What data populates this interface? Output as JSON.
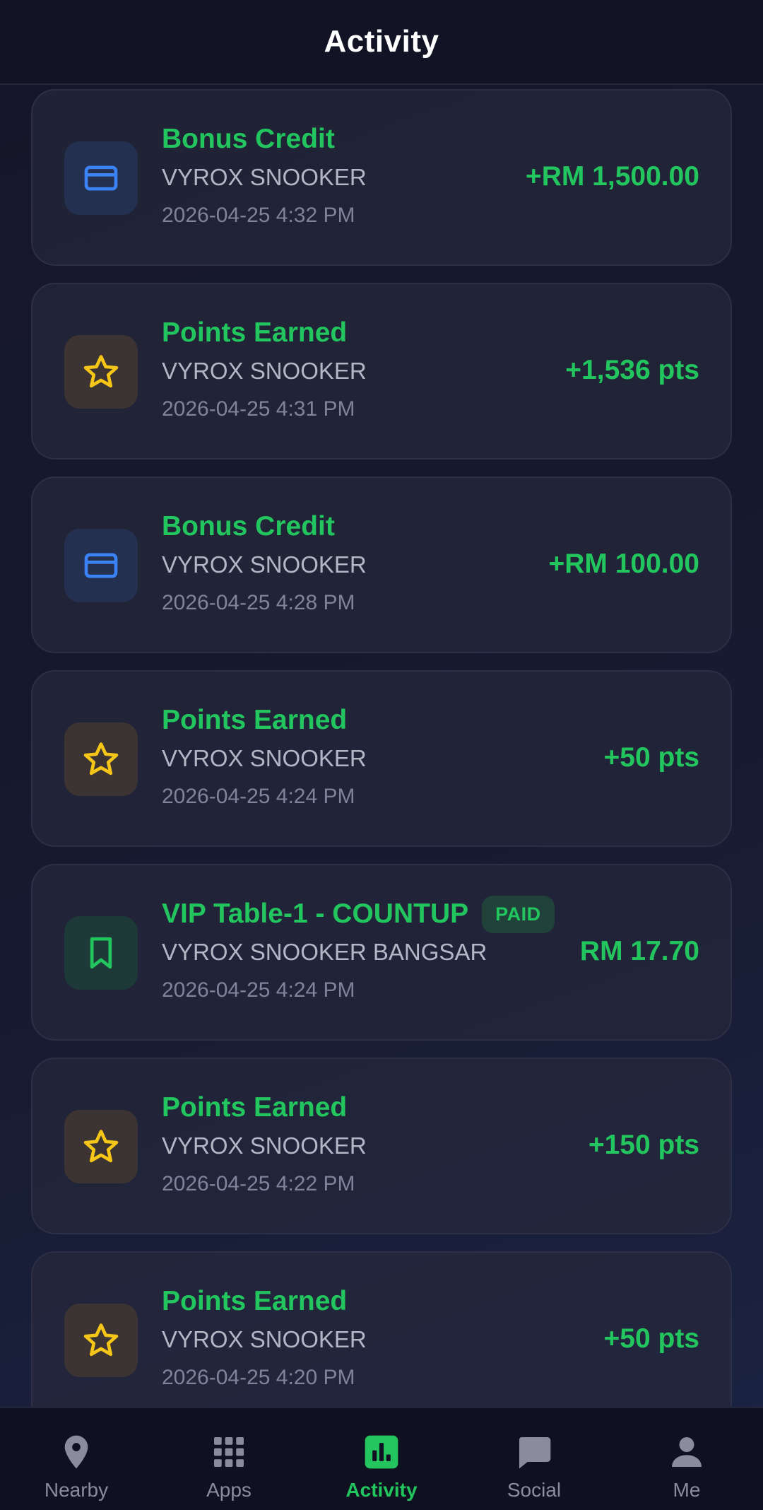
{
  "header": {
    "title": "Activity"
  },
  "colors": {
    "accent": "#22c55e",
    "credit_icon": "#3b82f6",
    "points_icon": "#f5c518",
    "inactive_nav": "#8a8c9c"
  },
  "transactions": [
    {
      "type": "credit",
      "icon": "credit-card-icon",
      "title": "Bonus Credit",
      "merchant": "VYROX SNOOKER",
      "time": "2026-04-25 4:32 PM",
      "amount": "+RM 1,500.00"
    },
    {
      "type": "points",
      "icon": "star-icon",
      "title": "Points Earned",
      "merchant": "VYROX SNOOKER",
      "time": "2026-04-25 4:31 PM",
      "amount": "+1,536 pts"
    },
    {
      "type": "credit",
      "icon": "credit-card-icon",
      "title": "Bonus Credit",
      "merchant": "VYROX SNOOKER",
      "time": "2026-04-25 4:28 PM",
      "amount": "+RM 100.00"
    },
    {
      "type": "points",
      "icon": "star-icon",
      "title": "Points Earned",
      "merchant": "VYROX SNOOKER",
      "time": "2026-04-25 4:24 PM",
      "amount": "+50 pts"
    },
    {
      "type": "table",
      "icon": "bookmark-icon",
      "title": "VIP Table-1 - COUNTUP",
      "badge": "PAID",
      "merchant": "VYROX SNOOKER BANGSAR",
      "time": "2026-04-25 4:24 PM",
      "amount": "RM 17.70"
    },
    {
      "type": "points",
      "icon": "star-icon",
      "title": "Points Earned",
      "merchant": "VYROX SNOOKER",
      "time": "2026-04-25 4:22 PM",
      "amount": "+150 pts"
    },
    {
      "type": "points",
      "icon": "star-icon",
      "title": "Points Earned",
      "merchant": "VYROX SNOOKER",
      "time": "2026-04-25 4:20 PM",
      "amount": "+50 pts"
    }
  ],
  "nav": {
    "items": [
      {
        "label": "Nearby",
        "icon": "location-pin-icon",
        "active": false
      },
      {
        "label": "Apps",
        "icon": "grid-icon",
        "active": false
      },
      {
        "label": "Activity",
        "icon": "bar-chart-icon",
        "active": true
      },
      {
        "label": "Social",
        "icon": "chat-bubble-icon",
        "active": false
      },
      {
        "label": "Me",
        "icon": "person-icon",
        "active": false
      }
    ]
  }
}
